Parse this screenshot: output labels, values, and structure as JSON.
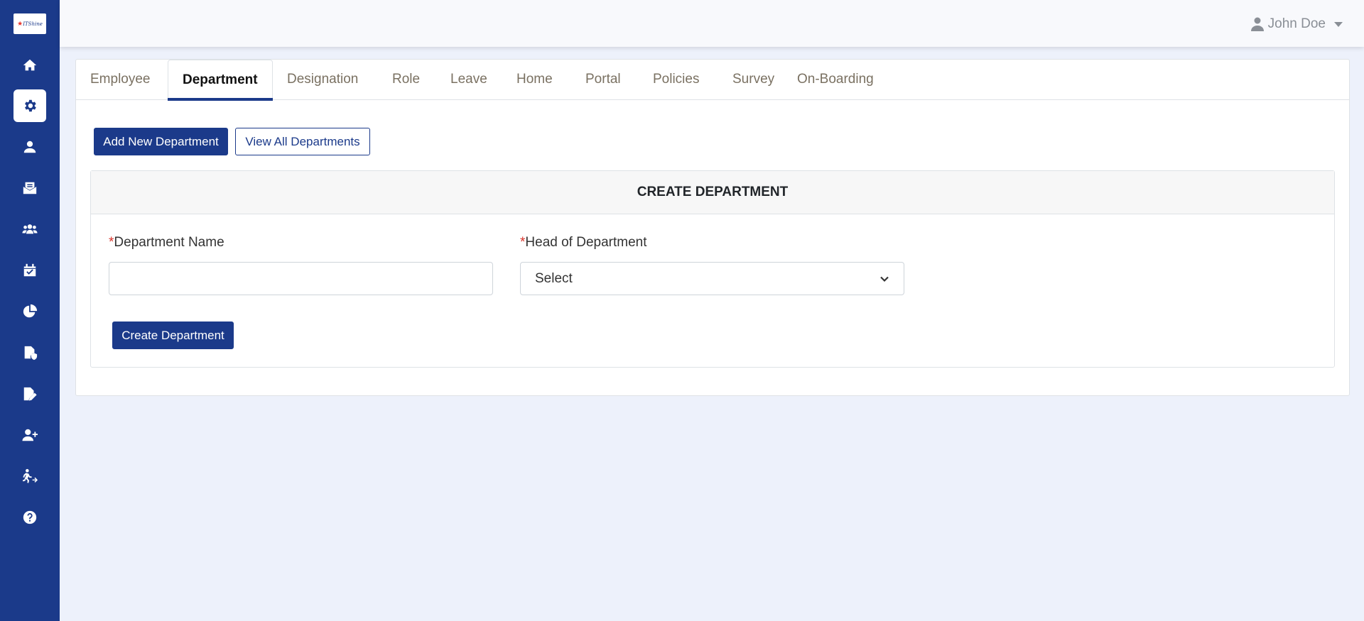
{
  "logo": {
    "text": "ITShine"
  },
  "sidebar": {
    "items": [
      {
        "name": "home-icon"
      },
      {
        "name": "gear-icon",
        "active": true
      },
      {
        "name": "user-icon"
      },
      {
        "name": "mail-inbox-icon"
      },
      {
        "name": "users-group-icon"
      },
      {
        "name": "calendar-check-icon"
      },
      {
        "name": "pie-chart-icon"
      },
      {
        "name": "file-shield-icon"
      },
      {
        "name": "file-edit-icon"
      },
      {
        "name": "user-plus-icon"
      },
      {
        "name": "person-exit-icon"
      },
      {
        "name": "help-icon"
      }
    ]
  },
  "header": {
    "user_name": "John Doe"
  },
  "tabs": [
    "Employee",
    "Department",
    "Designation",
    "Role",
    "Leave",
    "Home",
    "Portal",
    "Policies",
    "Survey",
    "On-Boarding"
  ],
  "active_tab": "Department",
  "actions": {
    "add_new": "Add New Department",
    "view_all": "View All Departments"
  },
  "form": {
    "title": "CREATE DEPARTMENT",
    "required_mark": "*",
    "department_name_label": "Department Name",
    "department_name_value": "",
    "head_label": "Head of Department",
    "head_selected": "Select",
    "submit_label": "Create Department"
  },
  "colors": {
    "primary": "#1b3a8a",
    "background": "#edf1fb",
    "required": "#d9342b"
  }
}
